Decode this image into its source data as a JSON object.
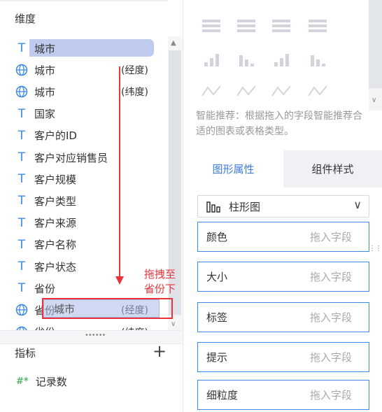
{
  "dimensions": {
    "title": "维度",
    "items": [
      {
        "icon": "text-type-icon",
        "label": "城市",
        "suffix": "",
        "selected": true
      },
      {
        "icon": "globe-icon",
        "label": "城市",
        "suffix": "(经度)"
      },
      {
        "icon": "globe-icon",
        "label": "城市",
        "suffix": "(纬度)"
      },
      {
        "icon": "text-type-icon",
        "label": "国家",
        "suffix": ""
      },
      {
        "icon": "text-type-icon",
        "label": "客户的ID",
        "suffix": ""
      },
      {
        "icon": "text-type-icon",
        "label": "客户对应销售员",
        "suffix": ""
      },
      {
        "icon": "text-type-icon",
        "label": "客户规模",
        "suffix": ""
      },
      {
        "icon": "text-type-icon",
        "label": "客户类型",
        "suffix": ""
      },
      {
        "icon": "text-type-icon",
        "label": "客户来源",
        "suffix": ""
      },
      {
        "icon": "text-type-icon",
        "label": "客户名称",
        "suffix": ""
      },
      {
        "icon": "text-type-icon",
        "label": "客户状态",
        "suffix": ""
      },
      {
        "icon": "text-type-icon",
        "label": "省份",
        "suffix": ""
      },
      {
        "icon": "globe-icon",
        "label": "省份",
        "suffix": "(经度)"
      },
      {
        "icon": "globe-icon",
        "label": "省份",
        "suffix": "(纬度)"
      }
    ]
  },
  "drag": {
    "ghost_label": "城市",
    "annotation": "拖拽至省份下"
  },
  "metrics": {
    "title": "指标",
    "add_label": "+",
    "items": [
      {
        "label": "记录数",
        "icon_text": "#*"
      }
    ]
  },
  "recommend_text": "智能推荐：根据拖入的字段智能推荐合适的图表或表格类型。",
  "tabs": [
    {
      "label": "图形属性",
      "active": true
    },
    {
      "label": "组件样式",
      "active": false
    }
  ],
  "chart_type": {
    "label": "柱形图"
  },
  "slots": [
    {
      "name": "颜色",
      "placeholder": "拖入字段"
    },
    {
      "name": "大小",
      "placeholder": "拖入字段"
    },
    {
      "name": "标签",
      "placeholder": "拖入字段"
    },
    {
      "name": "提示",
      "placeholder": "拖入字段"
    },
    {
      "name": "细粒度",
      "placeholder": "拖入字段"
    }
  ],
  "colors": {
    "accent": "#3d8ae6",
    "annotation_red": "#e8333a",
    "selection": "#bfcbee"
  }
}
